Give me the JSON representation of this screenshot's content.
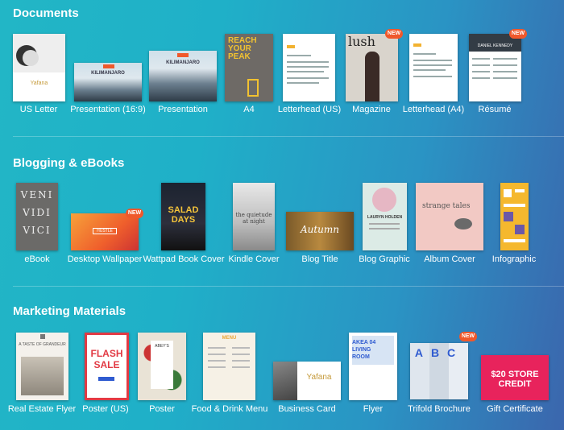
{
  "sections": {
    "documents": {
      "title": "Documents",
      "items": [
        {
          "label": "US Letter",
          "thumb_text": "Yafana"
        },
        {
          "label": "Presentation (16:9)",
          "thumb_text": "KILIMANJARO"
        },
        {
          "label": "Presentation",
          "thumb_text": "KILIMANJARO"
        },
        {
          "label": "A4",
          "thumb_text": "REACH YOUR PEAK"
        },
        {
          "label": "Letterhead (US)",
          "thumb_text": ""
        },
        {
          "label": "Magazine",
          "thumb_text": "lush"
        },
        {
          "label": "Letterhead (A4)",
          "thumb_text": ""
        },
        {
          "label": "Résumé",
          "thumb_text": "DANIEL KENNEDY"
        }
      ]
    },
    "blogging": {
      "title": "Blogging & eBooks",
      "items": [
        {
          "label": "eBook",
          "thumb_text": "VENI VIDI VICI"
        },
        {
          "label": "Desktop Wallpaper",
          "thumb_text": "HUSTLE"
        },
        {
          "label": "Wattpad Book Cover",
          "thumb_text": "SALAD DAYS"
        },
        {
          "label": "Kindle Cover",
          "thumb_text": "the quietude at night"
        },
        {
          "label": "Blog Title",
          "thumb_text": "Autumn"
        },
        {
          "label": "Blog Graphic",
          "thumb_text": "LAURYN HOLDEN"
        },
        {
          "label": "Album Cover",
          "thumb_text": "strange tales"
        },
        {
          "label": "Infographic",
          "thumb_text": ""
        }
      ]
    },
    "marketing": {
      "title": "Marketing Materials",
      "items": [
        {
          "label": "Real Estate Flyer",
          "thumb_text": "A TASTE OF GRANDEUR"
        },
        {
          "label": "Poster (US)",
          "thumb_text": "FLASH SALE"
        },
        {
          "label": "Poster",
          "thumb_text": "ABEY'S"
        },
        {
          "label": "Food & Drink Menu",
          "thumb_text": "MENU"
        },
        {
          "label": "Business Card",
          "thumb_text": "Yafana"
        },
        {
          "label": "Flyer",
          "thumb_text": "AKEA 04 LIVING ROOM"
        },
        {
          "label": "Trifold Brochure",
          "thumb_text": "ABC"
        },
        {
          "label": "Gift Certificate",
          "thumb_text": "$20 STORE CREDIT"
        }
      ]
    }
  },
  "badge_new": "NEW",
  "colors": {
    "badge": "#f0582b",
    "text": "#ffffff"
  }
}
